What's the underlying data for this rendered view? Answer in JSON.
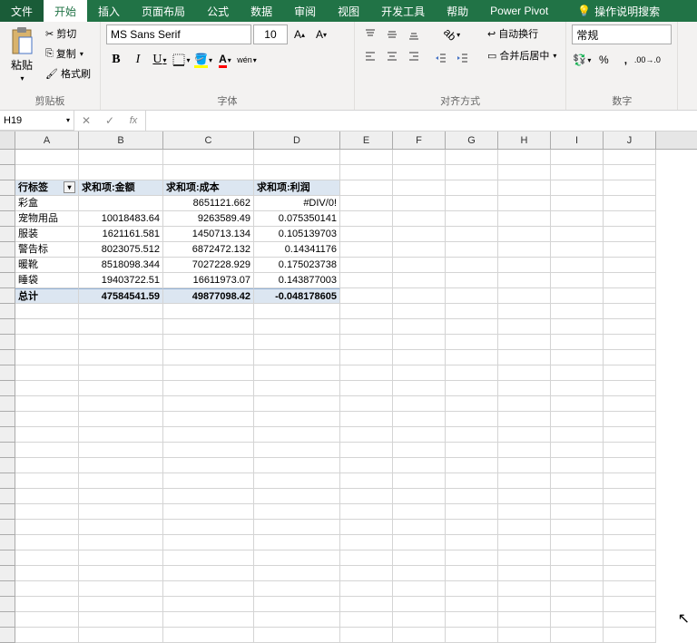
{
  "tabs": {
    "file": "文件",
    "home": "开始",
    "insert": "插入",
    "layout": "页面布局",
    "formulas": "公式",
    "data": "数据",
    "review": "审阅",
    "view": "视图",
    "dev": "开发工具",
    "help": "帮助",
    "powerpivot": "Power Pivot",
    "tellme": "操作说明搜索"
  },
  "ribbon": {
    "paste": "粘贴",
    "cut": "剪切",
    "copy": "复制",
    "formatpainter": "格式刷",
    "clipboard_label": "剪贴板",
    "font_name": "MS Sans Serif",
    "font_size": "10",
    "font_label": "字体",
    "wrap_text": "自动换行",
    "merge": "合并后居中",
    "align_label": "对齐方式",
    "number_format": "常规",
    "number_label": "数字",
    "wen": "wén"
  },
  "namebox": "H19",
  "columns": [
    "A",
    "B",
    "C",
    "D",
    "E",
    "F",
    "G",
    "H",
    "I",
    "J"
  ],
  "pivot": {
    "row_label": "行标签",
    "col_b": "求和项:金额",
    "col_c": "求和项:成本",
    "col_d": "求和项:利润",
    "rows": [
      {
        "a": "彩盒",
        "b": "",
        "c": "8651121.662",
        "d": "#DIV/0!"
      },
      {
        "a": "宠物用品",
        "b": "10018483.64",
        "c": "9263589.49",
        "d": "0.075350141"
      },
      {
        "a": "服装",
        "b": "1621161.581",
        "c": "1450713.134",
        "d": "0.105139703"
      },
      {
        "a": "警告标",
        "b": "8023075.512",
        "c": "6872472.132",
        "d": "0.14341176"
      },
      {
        "a": "暖靴",
        "b": "8518098.344",
        "c": "7027228.929",
        "d": "0.175023738"
      },
      {
        "a": "睡袋",
        "b": "19403722.51",
        "c": "16611973.07",
        "d": "0.143877003"
      }
    ],
    "total_label": "总计",
    "total_b": "47584541.59",
    "total_c": "49877098.42",
    "total_d": "-0.048178605"
  }
}
